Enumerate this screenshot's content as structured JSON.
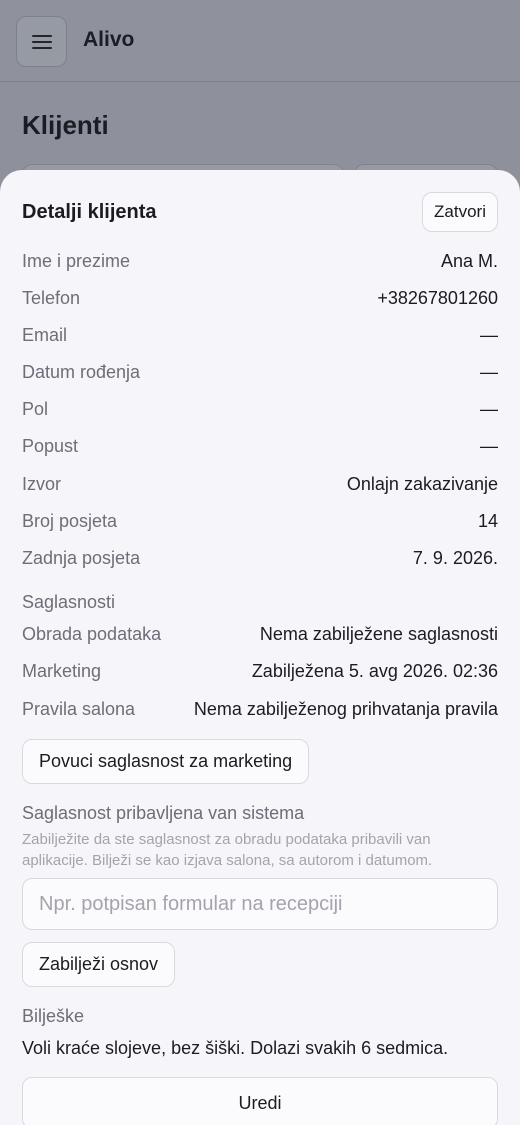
{
  "app": {
    "title": "Alivo"
  },
  "page": {
    "title": "Klijenti"
  },
  "sheet": {
    "title": "Detalji klijenta",
    "close_label": "Zatvori",
    "details": [
      {
        "label": "Ime i prezime",
        "value": "Ana M."
      },
      {
        "label": "Telefon",
        "value": "+38267801260"
      },
      {
        "label": "Email",
        "value": "—"
      },
      {
        "label": "Datum rođenja",
        "value": "—"
      },
      {
        "label": "Pol",
        "value": "—"
      },
      {
        "label": "Popust",
        "value": "—"
      },
      {
        "label": "Izvor",
        "value": "Onlajn zakazivanje"
      },
      {
        "label": "Broj posjeta",
        "value": "14"
      },
      {
        "label": "Zadnja posjeta",
        "value": "7. 9. 2026."
      }
    ],
    "consents": {
      "heading": "Saglasnosti",
      "items": [
        {
          "label": "Obrada podataka",
          "value": "Nema zabilježene saglasnosti"
        },
        {
          "label": "Marketing",
          "value": "Zabilježena 5. avg 2026. 02:36"
        },
        {
          "label": "Pravila salona",
          "value": "Nema zabilježenog prihvatanja pravila"
        }
      ],
      "revoke_label": "Povuci saglasnost za marketing"
    },
    "offline": {
      "heading": "Saglasnost pribavljena van sistema",
      "help": "Zabilježite da ste saglasnost za obradu podataka pribavili van aplikacije. Bilježi se kao izjava salona, sa autorom i datumom.",
      "input_value": "",
      "input_placeholder": "Npr. potpisan formular na recepciji",
      "record_label": "Zabilježi osnov"
    },
    "notes": {
      "heading": "Bilješke",
      "text": "Voli kraće slojeve, bez šiški. Dolazi svakih 6 sedmica."
    },
    "edit_label": "Uredi"
  }
}
